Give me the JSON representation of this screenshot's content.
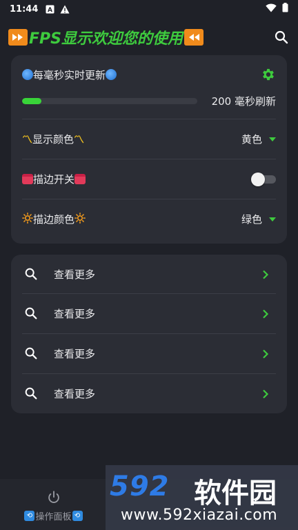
{
  "status_bar": {
    "time": "11:44",
    "icons": [
      "a-box-icon",
      "warning-icon"
    ],
    "right_icons": [
      "wifi-icon",
      "battery-icon"
    ]
  },
  "app_bar": {
    "title": "FPS显示欢迎您的使用",
    "left_badge_icon": "fast-forward-icon",
    "right_badge_icon": "fast-rewind-icon",
    "title_color": "#3ecb3e",
    "badge_color": "#f08b1c",
    "action_icon": "search-icon"
  },
  "settings_card": {
    "refresh": {
      "label": "每毫秒实时更新",
      "emoji": "globe",
      "settings_icon": "gear-icon",
      "progress_fraction": 0.11,
      "progress_text": "200 毫秒刷新",
      "accent_color": "#39d439"
    },
    "display_color": {
      "label": "显示颜色",
      "emoji": "rising-arrows",
      "value": "黄色"
    },
    "outline_switch": {
      "label": "描边开关",
      "emoji": "calendar",
      "on": false
    },
    "outline_color": {
      "label": "描边颜色",
      "emoji": "sun",
      "value": "绿色"
    }
  },
  "more_list": {
    "items": [
      {
        "label": "查看更多",
        "icon": "search-icon"
      },
      {
        "label": "查看更多",
        "icon": "search-icon"
      },
      {
        "label": "查看更多",
        "icon": "search-icon"
      },
      {
        "label": "查看更多",
        "icon": "search-icon"
      }
    ]
  },
  "bottom_nav": {
    "items": [
      {
        "label": "操作面板",
        "icon": "power-icon",
        "decor_icon": "cycle-icon"
      }
    ]
  },
  "watermark": {
    "logo_number": "592",
    "logo_text": "软件园",
    "url": "www.592xiazai.com",
    "logo_color": "#2e7be6"
  }
}
